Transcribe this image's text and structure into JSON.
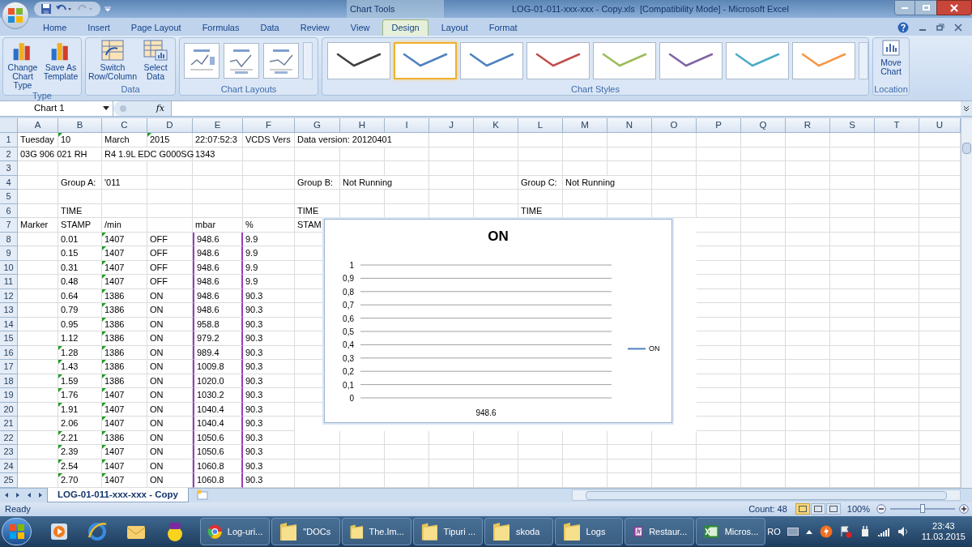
{
  "window": {
    "context_label": "Chart Tools",
    "title": "LOG-01-011-xxx-xxx - Copy.xls  [Compatibility Mode] - Microsoft Excel"
  },
  "tabs": [
    {
      "label": "Home",
      "selected": false
    },
    {
      "label": "Insert",
      "selected": false
    },
    {
      "label": "Page Layout",
      "selected": false
    },
    {
      "label": "Formulas",
      "selected": false
    },
    {
      "label": "Data",
      "selected": false
    },
    {
      "label": "Review",
      "selected": false
    },
    {
      "label": "View",
      "selected": false
    },
    {
      "label": "Design",
      "selected": true
    },
    {
      "label": "Layout",
      "selected": false
    },
    {
      "label": "Format",
      "selected": false
    }
  ],
  "ribbon": {
    "type_group": {
      "label": "Type",
      "buttons": [
        "Change Chart Type",
        "Save As Template"
      ]
    },
    "data_group": {
      "label": "Data",
      "buttons": [
        "Switch Row/Column",
        "Select Data"
      ]
    },
    "layouts_group": {
      "label": "Chart Layouts"
    },
    "styles_group": {
      "label": "Chart Styles",
      "styles": [
        {
          "color": "#404040",
          "selected": false
        },
        {
          "color": "#4f81bd",
          "selected": true
        },
        {
          "color": "#4f81bd",
          "selected": false
        },
        {
          "color": "#c0504d",
          "selected": false
        },
        {
          "color": "#9bbb59",
          "selected": false
        },
        {
          "color": "#8064a2",
          "selected": false
        },
        {
          "color": "#4bacc6",
          "selected": false
        },
        {
          "color": "#f79646",
          "selected": false
        }
      ]
    },
    "location_group": {
      "label": "Location",
      "button": "Move Chart"
    }
  },
  "formula_bar": {
    "name_box": "Chart 1",
    "function_label": "fx"
  },
  "columns": [
    "A",
    "B",
    "C",
    "D",
    "E",
    "F",
    "G",
    "H",
    "I",
    "J",
    "K",
    "L",
    "M",
    "N",
    "O",
    "P",
    "Q",
    "R",
    "S",
    "T",
    "U"
  ],
  "rows": [
    {
      "number": "1",
      "cells": {
        "A": {
          "text": "Tuesday"
        },
        "B": {
          "text": "10",
          "flagged": true
        },
        "C": {
          "text": "March"
        },
        "D": {
          "text": "2015",
          "flagged": true
        },
        "E": {
          "text": "22:07:52:3"
        },
        "F": {
          "text": "VCDS Vers"
        },
        "G": {
          "text": "Data version: 20120401"
        }
      }
    },
    {
      "number": "2",
      "cells": {
        "A": {
          "text": "03G 906 021 RH"
        },
        "C": {
          "text": "R4 1.9L EDC G000SG"
        },
        "E": {
          "text": "1343"
        }
      }
    },
    {
      "number": "3",
      "cells": {}
    },
    {
      "number": "4",
      "cells": {
        "B": {
          "text": "Group A:"
        },
        "C": {
          "text": "'011"
        },
        "G": {
          "text": "Group B:"
        },
        "H": {
          "text": "Not Running"
        },
        "L": {
          "text": "Group C:"
        },
        "M": {
          "text": "Not Running"
        }
      }
    },
    {
      "number": "5",
      "cells": {}
    },
    {
      "number": "6",
      "cells": {
        "B": {
          "text": "TIME"
        },
        "G": {
          "text": "TIME"
        },
        "L": {
          "text": "TIME"
        }
      }
    },
    {
      "number": "7",
      "cells": {
        "A": {
          "text": "Marker"
        },
        "B": {
          "text": "STAMP"
        },
        "C": {
          "text": "/min"
        },
        "E": {
          "text": "mbar"
        },
        "F": {
          "text": "%"
        },
        "G": {
          "text": "STAM"
        }
      }
    },
    {
      "number": "8",
      "cells": {
        "B": {
          "text": "0.01",
          "flagged": false
        },
        "C": {
          "text": "1407",
          "flagged": true
        },
        "D": {
          "text": "OFF"
        },
        "E": {
          "text": "948.6",
          "highlighted": true
        },
        "F": {
          "text": "9.9"
        }
      }
    },
    {
      "number": "9",
      "cells": {
        "B": {
          "text": "0.15",
          "flagged": false
        },
        "C": {
          "text": "1407",
          "flagged": true
        },
        "D": {
          "text": "OFF"
        },
        "E": {
          "text": "948.6",
          "highlighted": true
        },
        "F": {
          "text": "9.9"
        }
      }
    },
    {
      "number": "10",
      "cells": {
        "B": {
          "text": "0.31",
          "flagged": false
        },
        "C": {
          "text": "1407",
          "flagged": true
        },
        "D": {
          "text": "OFF"
        },
        "E": {
          "text": "948.6",
          "highlighted": true
        },
        "F": {
          "text": "9.9"
        }
      }
    },
    {
      "number": "11",
      "cells": {
        "B": {
          "text": "0.48",
          "flagged": false
        },
        "C": {
          "text": "1407",
          "flagged": true
        },
        "D": {
          "text": "OFF"
        },
        "E": {
          "text": "948.6",
          "highlighted": true
        },
        "F": {
          "text": "9.9"
        }
      }
    },
    {
      "number": "12",
      "cells": {
        "B": {
          "text": "0.64",
          "flagged": false
        },
        "C": {
          "text": "1386",
          "flagged": true
        },
        "D": {
          "text": "ON"
        },
        "E": {
          "text": "948.6",
          "highlighted": true
        },
        "F": {
          "text": "90.3"
        }
      }
    },
    {
      "number": "13",
      "cells": {
        "B": {
          "text": "0.79",
          "flagged": false
        },
        "C": {
          "text": "1386",
          "flagged": true
        },
        "D": {
          "text": "ON"
        },
        "E": {
          "text": "948.6",
          "highlighted": true
        },
        "F": {
          "text": "90.3"
        }
      }
    },
    {
      "number": "14",
      "cells": {
        "B": {
          "text": "0.95",
          "flagged": false
        },
        "C": {
          "text": "1386",
          "flagged": true
        },
        "D": {
          "text": "ON"
        },
        "E": {
          "text": "958.8",
          "highlighted": true
        },
        "F": {
          "text": "90.3"
        }
      }
    },
    {
      "number": "15",
      "cells": {
        "B": {
          "text": "1.12",
          "flagged": false
        },
        "C": {
          "text": "1386",
          "flagged": true
        },
        "D": {
          "text": "ON"
        },
        "E": {
          "text": "979.2",
          "highlighted": true
        },
        "F": {
          "text": "90.3"
        }
      }
    },
    {
      "number": "16",
      "cells": {
        "B": {
          "text": "1.28",
          "flagged": true
        },
        "C": {
          "text": "1386",
          "flagged": true
        },
        "D": {
          "text": "ON"
        },
        "E": {
          "text": "989.4",
          "highlighted": true
        },
        "F": {
          "text": "90.3"
        }
      }
    },
    {
      "number": "17",
      "cells": {
        "B": {
          "text": "1.43",
          "flagged": true
        },
        "C": {
          "text": "1386",
          "flagged": true
        },
        "D": {
          "text": "ON"
        },
        "E": {
          "text": "1009.8",
          "highlighted": true
        },
        "F": {
          "text": "90.3"
        }
      }
    },
    {
      "number": "18",
      "cells": {
        "B": {
          "text": "1.59",
          "flagged": true
        },
        "C": {
          "text": "1386",
          "flagged": true
        },
        "D": {
          "text": "ON"
        },
        "E": {
          "text": "1020.0",
          "highlighted": true
        },
        "F": {
          "text": "90.3"
        }
      }
    },
    {
      "number": "19",
      "cells": {
        "B": {
          "text": "1.76",
          "flagged": true
        },
        "C": {
          "text": "1407",
          "flagged": true
        },
        "D": {
          "text": "ON"
        },
        "E": {
          "text": "1030.2",
          "highlighted": true
        },
        "F": {
          "text": "90.3"
        }
      }
    },
    {
      "number": "20",
      "cells": {
        "B": {
          "text": "1.91",
          "flagged": true
        },
        "C": {
          "text": "1407",
          "flagged": true
        },
        "D": {
          "text": "ON"
        },
        "E": {
          "text": "1040.4",
          "highlighted": true
        },
        "F": {
          "text": "90.3"
        }
      }
    },
    {
      "number": "21",
      "cells": {
        "B": {
          "text": "2.06",
          "flagged": false
        },
        "C": {
          "text": "1407",
          "flagged": true
        },
        "D": {
          "text": "ON"
        },
        "E": {
          "text": "1040.4",
          "highlighted": true
        },
        "F": {
          "text": "90.3"
        }
      }
    },
    {
      "number": "22",
      "cells": {
        "B": {
          "text": "2.21",
          "flagged": true
        },
        "C": {
          "text": "1386",
          "flagged": true
        },
        "D": {
          "text": "ON"
        },
        "E": {
          "text": "1050.6",
          "highlighted": true
        },
        "F": {
          "text": "90.3"
        }
      }
    },
    {
      "number": "23",
      "cells": {
        "B": {
          "text": "2.39",
          "flagged": true
        },
        "C": {
          "text": "1407",
          "flagged": true
        },
        "D": {
          "text": "ON"
        },
        "E": {
          "text": "1050.6",
          "highlighted": true
        },
        "F": {
          "text": "90.3"
        }
      }
    },
    {
      "number": "24",
      "cells": {
        "B": {
          "text": "2.54",
          "flagged": true
        },
        "C": {
          "text": "1407",
          "flagged": true
        },
        "D": {
          "text": "ON"
        },
        "E": {
          "text": "1060.8",
          "highlighted": true
        },
        "F": {
          "text": "90.3"
        }
      }
    },
    {
      "number": "25",
      "cells": {
        "B": {
          "text": "2.70",
          "flagged": true
        },
        "C": {
          "text": "1407",
          "flagged": true
        },
        "D": {
          "text": "ON"
        },
        "E": {
          "text": "1060.8",
          "highlighted": true
        },
        "F": {
          "text": "90.3"
        }
      }
    }
  ],
  "chart": {
    "chart_data": {
      "type": "line",
      "title": "ON",
      "grid": true,
      "categories": [
        "948.6"
      ],
      "series": [
        {
          "name": "ON",
          "color": "#4f81bd",
          "values": [
            null
          ]
        }
      ],
      "ylim": [
        0,
        1
      ],
      "yticks": [
        {
          "value": 0,
          "label": "0"
        },
        {
          "value": 0.1,
          "label": "0,1"
        },
        {
          "value": 0.2,
          "label": "0,2"
        },
        {
          "value": 0.3,
          "label": "0,3"
        },
        {
          "value": 0.4,
          "label": "0,4"
        },
        {
          "value": 0.5,
          "label": "0,5"
        },
        {
          "value": 0.6,
          "label": "0,6"
        },
        {
          "value": 0.7,
          "label": "0,7"
        },
        {
          "value": 0.8,
          "label": "0,8"
        },
        {
          "value": 0.9,
          "label": "0,9"
        },
        {
          "value": 1,
          "label": "1"
        }
      ]
    }
  },
  "sheet_tabs": [
    {
      "label": "LOG-01-011-xxx-xxx - Copy",
      "selected": true
    }
  ],
  "status_bar": {
    "status": "Ready",
    "count": "Count: 48",
    "zoom": "100%",
    "zoom_slider": {
      "level": 0.5
    },
    "views": [
      {
        "selected": true
      },
      {
        "selected": false
      },
      {
        "selected": false
      }
    ]
  },
  "taskbar": {
    "tasks": [
      {
        "label": "Log-uri...",
        "kind": "browser"
      },
      {
        "label": "\"DOCs",
        "kind": "folder"
      },
      {
        "label": "The.Im...",
        "kind": "folder"
      },
      {
        "label": "Tipuri ...",
        "kind": "folder"
      },
      {
        "label": "skoda",
        "kind": "folder"
      },
      {
        "label": "Logs",
        "kind": "folder"
      },
      {
        "label": "Restaur...",
        "kind": "notes"
      },
      {
        "label": "Micros...",
        "kind": "sheet"
      }
    ],
    "language": "RO",
    "time": "23:43",
    "date": "11.03.2015"
  }
}
